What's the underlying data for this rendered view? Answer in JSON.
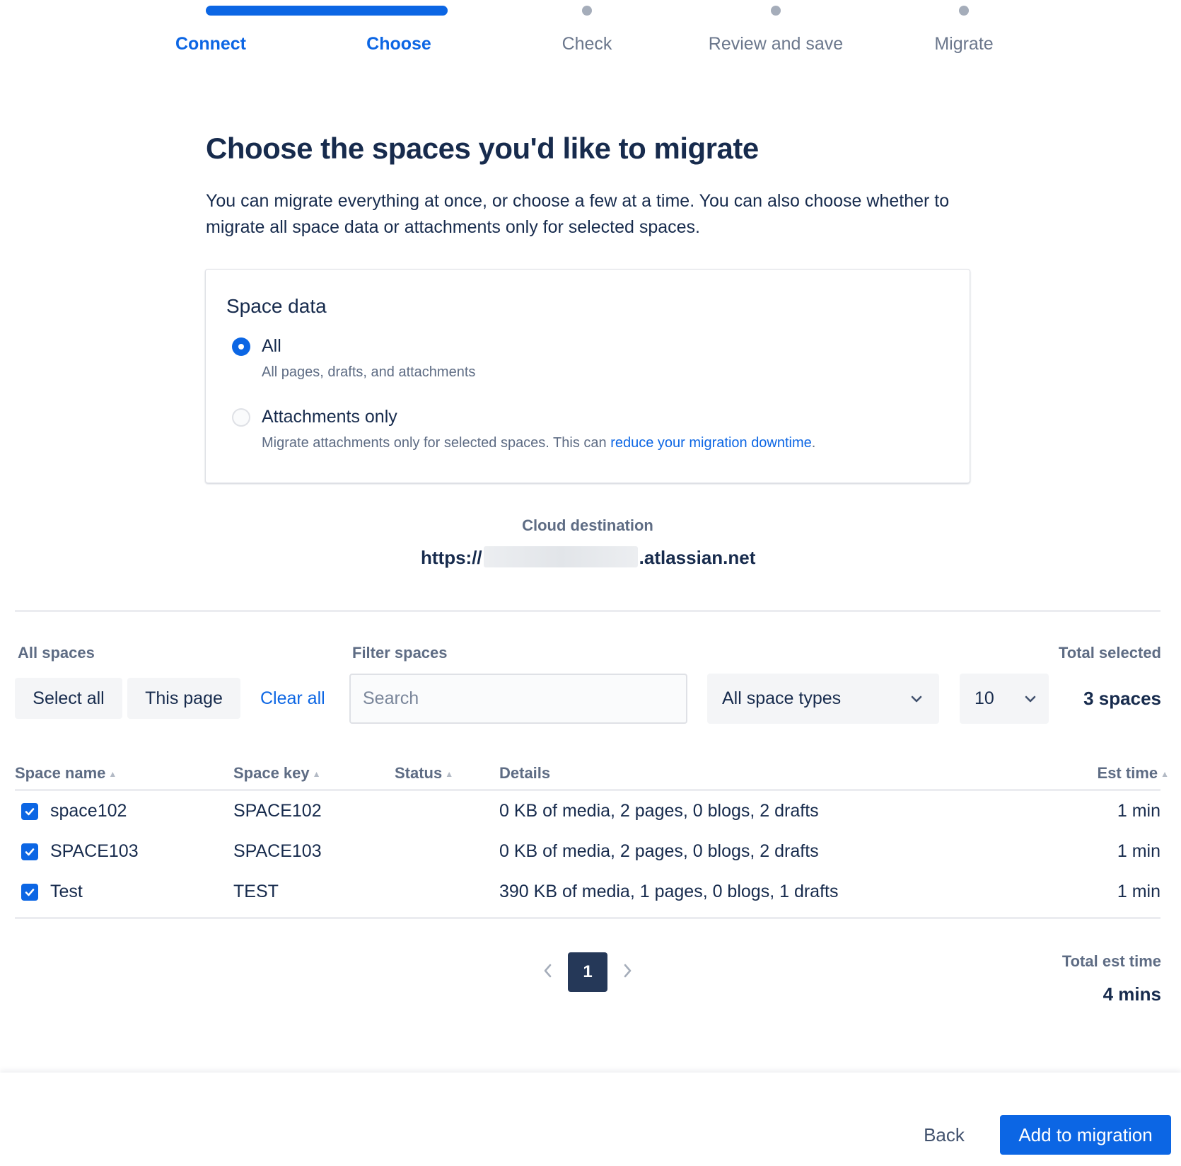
{
  "steps": [
    {
      "label": "Connect",
      "state": "complete"
    },
    {
      "label": "Choose",
      "state": "current"
    },
    {
      "label": "Check",
      "state": "upcoming"
    },
    {
      "label": "Review and save",
      "state": "upcoming"
    },
    {
      "label": "Migrate",
      "state": "upcoming"
    }
  ],
  "heading": {
    "title": "Choose the spaces you'd like to migrate",
    "description": "You can migrate everything at once, or choose a few at a time. You can also choose whether to migrate all space data or attachments only for selected spaces."
  },
  "space_data": {
    "title": "Space data",
    "selected": "all",
    "options": [
      {
        "id": "all",
        "label": "All",
        "description": "All pages, drafts, and attachments"
      },
      {
        "id": "attachments",
        "label": "Attachments only",
        "description": "Migrate attachments only for selected spaces. This can ",
        "link_text": "reduce your migration downtime",
        "description_end": "."
      }
    ]
  },
  "destination": {
    "label": "Cloud destination",
    "url_prefix": "https://",
    "url_suffix": ".atlassian.net"
  },
  "controls": {
    "all_spaces_label": "All spaces",
    "select_all": "Select all",
    "this_page": "This page",
    "clear_all": "Clear all",
    "filter_label": "Filter spaces",
    "search_placeholder": "Search",
    "space_type": "All space types",
    "page_size": "10",
    "total_selected_label": "Total selected",
    "total_selected": "3 spaces"
  },
  "table": {
    "columns": [
      "Space name",
      "Space key",
      "Status",
      "Details",
      "Est time"
    ],
    "rows": [
      {
        "checked": true,
        "name": "space102",
        "key": "SPACE102",
        "status": "",
        "details": "0 KB of media, 2 pages, 0 blogs, 2 drafts",
        "est": "1 min"
      },
      {
        "checked": true,
        "name": "SPACE103",
        "key": "SPACE103",
        "status": "",
        "details": "0 KB of media, 2 pages, 0 blogs, 2 drafts",
        "est": "1 min"
      },
      {
        "checked": true,
        "name": "Test",
        "key": "TEST",
        "status": "",
        "details": "390 KB of media, 1 pages, 0 blogs, 1 drafts",
        "est": "1 min"
      }
    ]
  },
  "pagination": {
    "current": "1",
    "prev_icon": "chevron-left-icon",
    "next_icon": "chevron-right-icon"
  },
  "totals": {
    "label": "Total est time",
    "value": "4 mins"
  },
  "footer": {
    "back": "Back",
    "primary": "Add to migration"
  },
  "colors": {
    "brand": "#0c66e4",
    "text": "#172b4d",
    "subtle": "#5e6c84",
    "page_bg": "#ffffff"
  }
}
